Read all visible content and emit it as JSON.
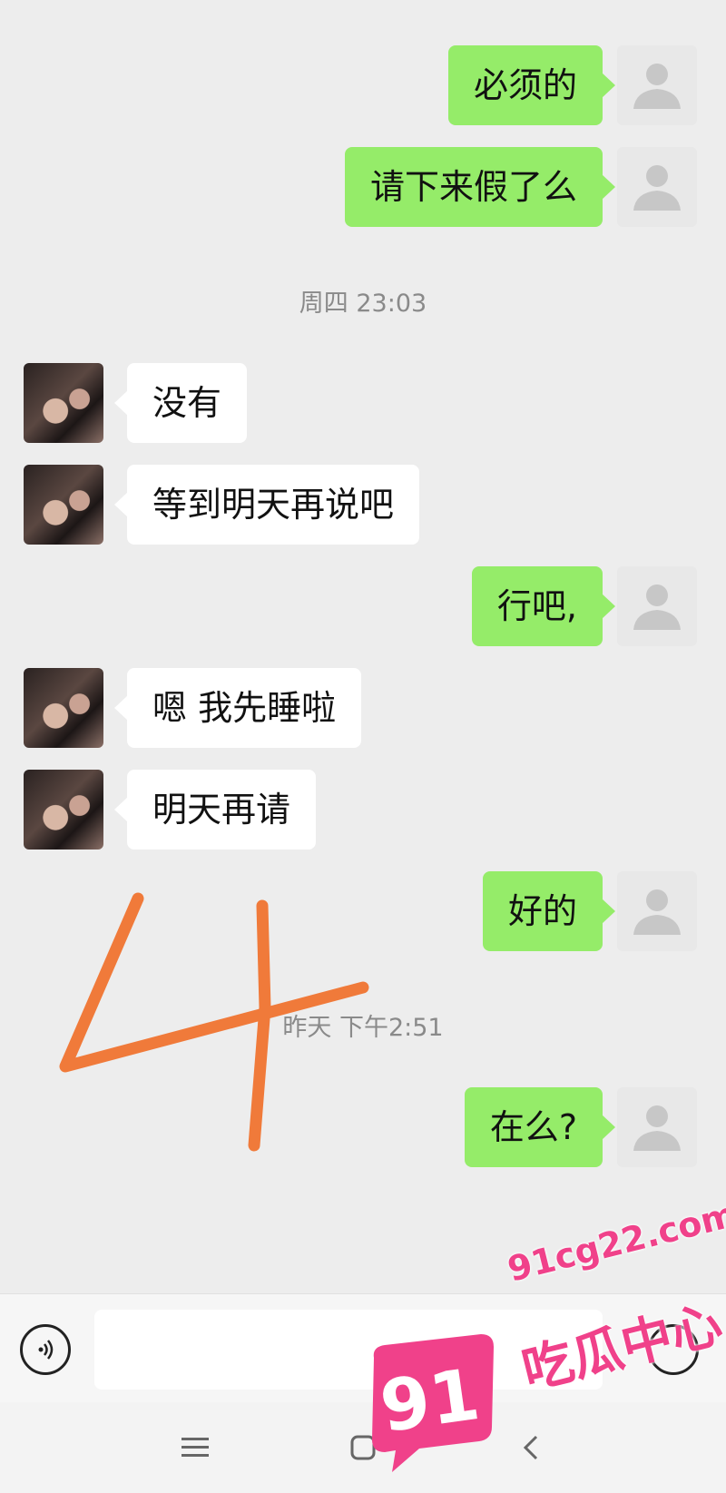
{
  "colors": {
    "background": "#ededed",
    "my_bubble": "#95ec69",
    "their_bubble": "#ffffff",
    "timestamp": "#8a8a8a",
    "scribble": "#f07a3a",
    "watermark": "#f0418a"
  },
  "messages": [
    {
      "from": "me",
      "text": "必须的"
    },
    {
      "from": "me",
      "text": "请下来假了么"
    },
    {
      "timestamp": "周四 23:03"
    },
    {
      "from": "them",
      "text": "没有"
    },
    {
      "from": "them",
      "text": "等到明天再说吧"
    },
    {
      "from": "me",
      "text": "行吧,"
    },
    {
      "from": "them",
      "text": "嗯 我先睡啦"
    },
    {
      "from": "them",
      "text": "明天再请"
    },
    {
      "from": "me",
      "text": "好的"
    },
    {
      "timestamp": "昨天 下午2:51"
    },
    {
      "from": "me",
      "text": "在么?"
    }
  ],
  "annotation": {
    "drawn_numeral": "4"
  },
  "input_bar": {
    "voice_icon": "voice-icon",
    "message_placeholder": "",
    "emoji_icon": "emoji-icon"
  },
  "nav_bar": {
    "icons": [
      "menu-icon",
      "home-icon",
      "back-icon"
    ]
  },
  "watermark": {
    "badge": "91",
    "domain": "91cg22.com",
    "name": "吃瓜中心"
  }
}
